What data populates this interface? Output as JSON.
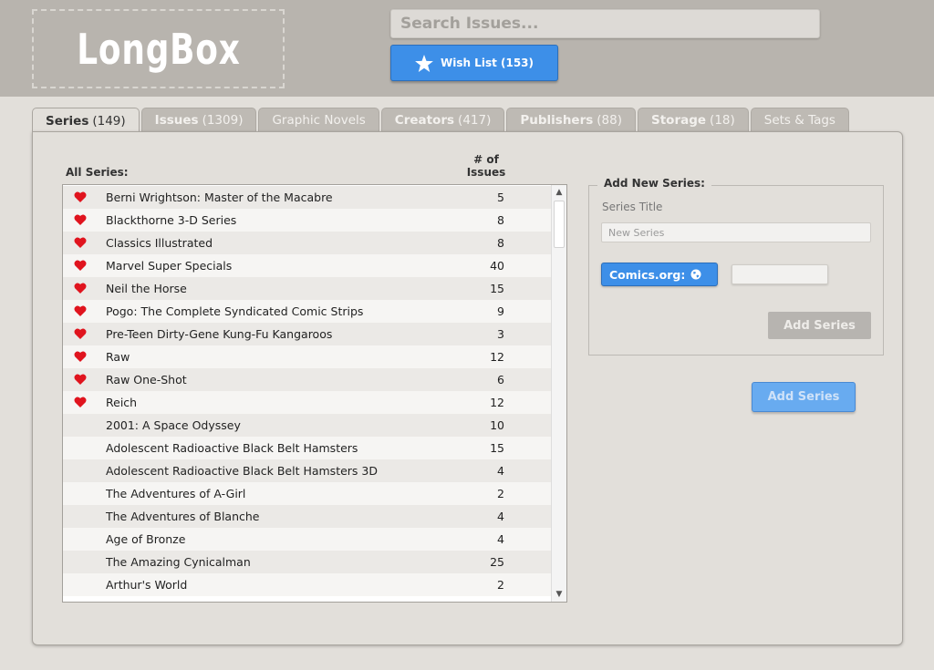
{
  "header": {
    "logo_text": "LongBox",
    "search_placeholder": "Search Issues...",
    "wishlist_label": "Wish List (153)"
  },
  "tabs": [
    {
      "bold": "Series",
      "rest": "(149)",
      "active": true
    },
    {
      "bold": "Issues",
      "rest": "(1309)",
      "active": false
    },
    {
      "bold": "",
      "rest": "Graphic Novels",
      "active": false
    },
    {
      "bold": "Creators",
      "rest": "(417)",
      "active": false
    },
    {
      "bold": "Publishers",
      "rest": "(88)",
      "active": false
    },
    {
      "bold": "Storage",
      "rest": "(18)",
      "active": false
    },
    {
      "bold": "",
      "rest": "Sets & Tags",
      "active": false
    }
  ],
  "series_list": {
    "header_name": "All Series:",
    "header_count": "# of Issues",
    "rows": [
      {
        "name": "Berni Wrightson: Master of the Macabre",
        "count": "5",
        "favorite": true
      },
      {
        "name": "Blackthorne 3-D Series",
        "count": "8",
        "favorite": true
      },
      {
        "name": "Classics Illustrated",
        "count": "8",
        "favorite": true
      },
      {
        "name": "Marvel Super Specials",
        "count": "40",
        "favorite": true
      },
      {
        "name": "Neil the Horse",
        "count": "15",
        "favorite": true
      },
      {
        "name": "Pogo: The Complete Syndicated Comic Strips",
        "count": "9",
        "favorite": true
      },
      {
        "name": "Pre-Teen Dirty-Gene Kung-Fu Kangaroos",
        "count": "3",
        "favorite": true
      },
      {
        "name": "Raw",
        "count": "12",
        "favorite": true
      },
      {
        "name": "Raw One-Shot",
        "count": "6",
        "favorite": true
      },
      {
        "name": "Reich",
        "count": "12",
        "favorite": true
      },
      {
        "name": "2001: A Space Odyssey",
        "count": "10",
        "favorite": false
      },
      {
        "name": "Adolescent Radioactive Black Belt Hamsters",
        "count": "15",
        "favorite": false
      },
      {
        "name": "Adolescent Radioactive Black Belt Hamsters 3D",
        "count": "4",
        "favorite": false
      },
      {
        "name": "The Adventures of A-Girl",
        "count": "2",
        "favorite": false
      },
      {
        "name": "The Adventures of Blanche",
        "count": "4",
        "favorite": false
      },
      {
        "name": "Age of Bronze",
        "count": "4",
        "favorite": false
      },
      {
        "name": "The Amazing Cynicalman",
        "count": "25",
        "favorite": false
      },
      {
        "name": "Arthur's World",
        "count": "2",
        "favorite": false
      }
    ]
  },
  "add_series": {
    "legend": "Add New Series:",
    "title_label": "Series Title",
    "title_placeholder": "New Series",
    "comics_button": "Comics.org:",
    "add_button_inner": "Add Series",
    "add_button_outer": "Add Series"
  },
  "colors": {
    "accent_blue": "#3d8fe8",
    "heart_red": "#e0141e",
    "header_bg": "#b8b4ae"
  }
}
